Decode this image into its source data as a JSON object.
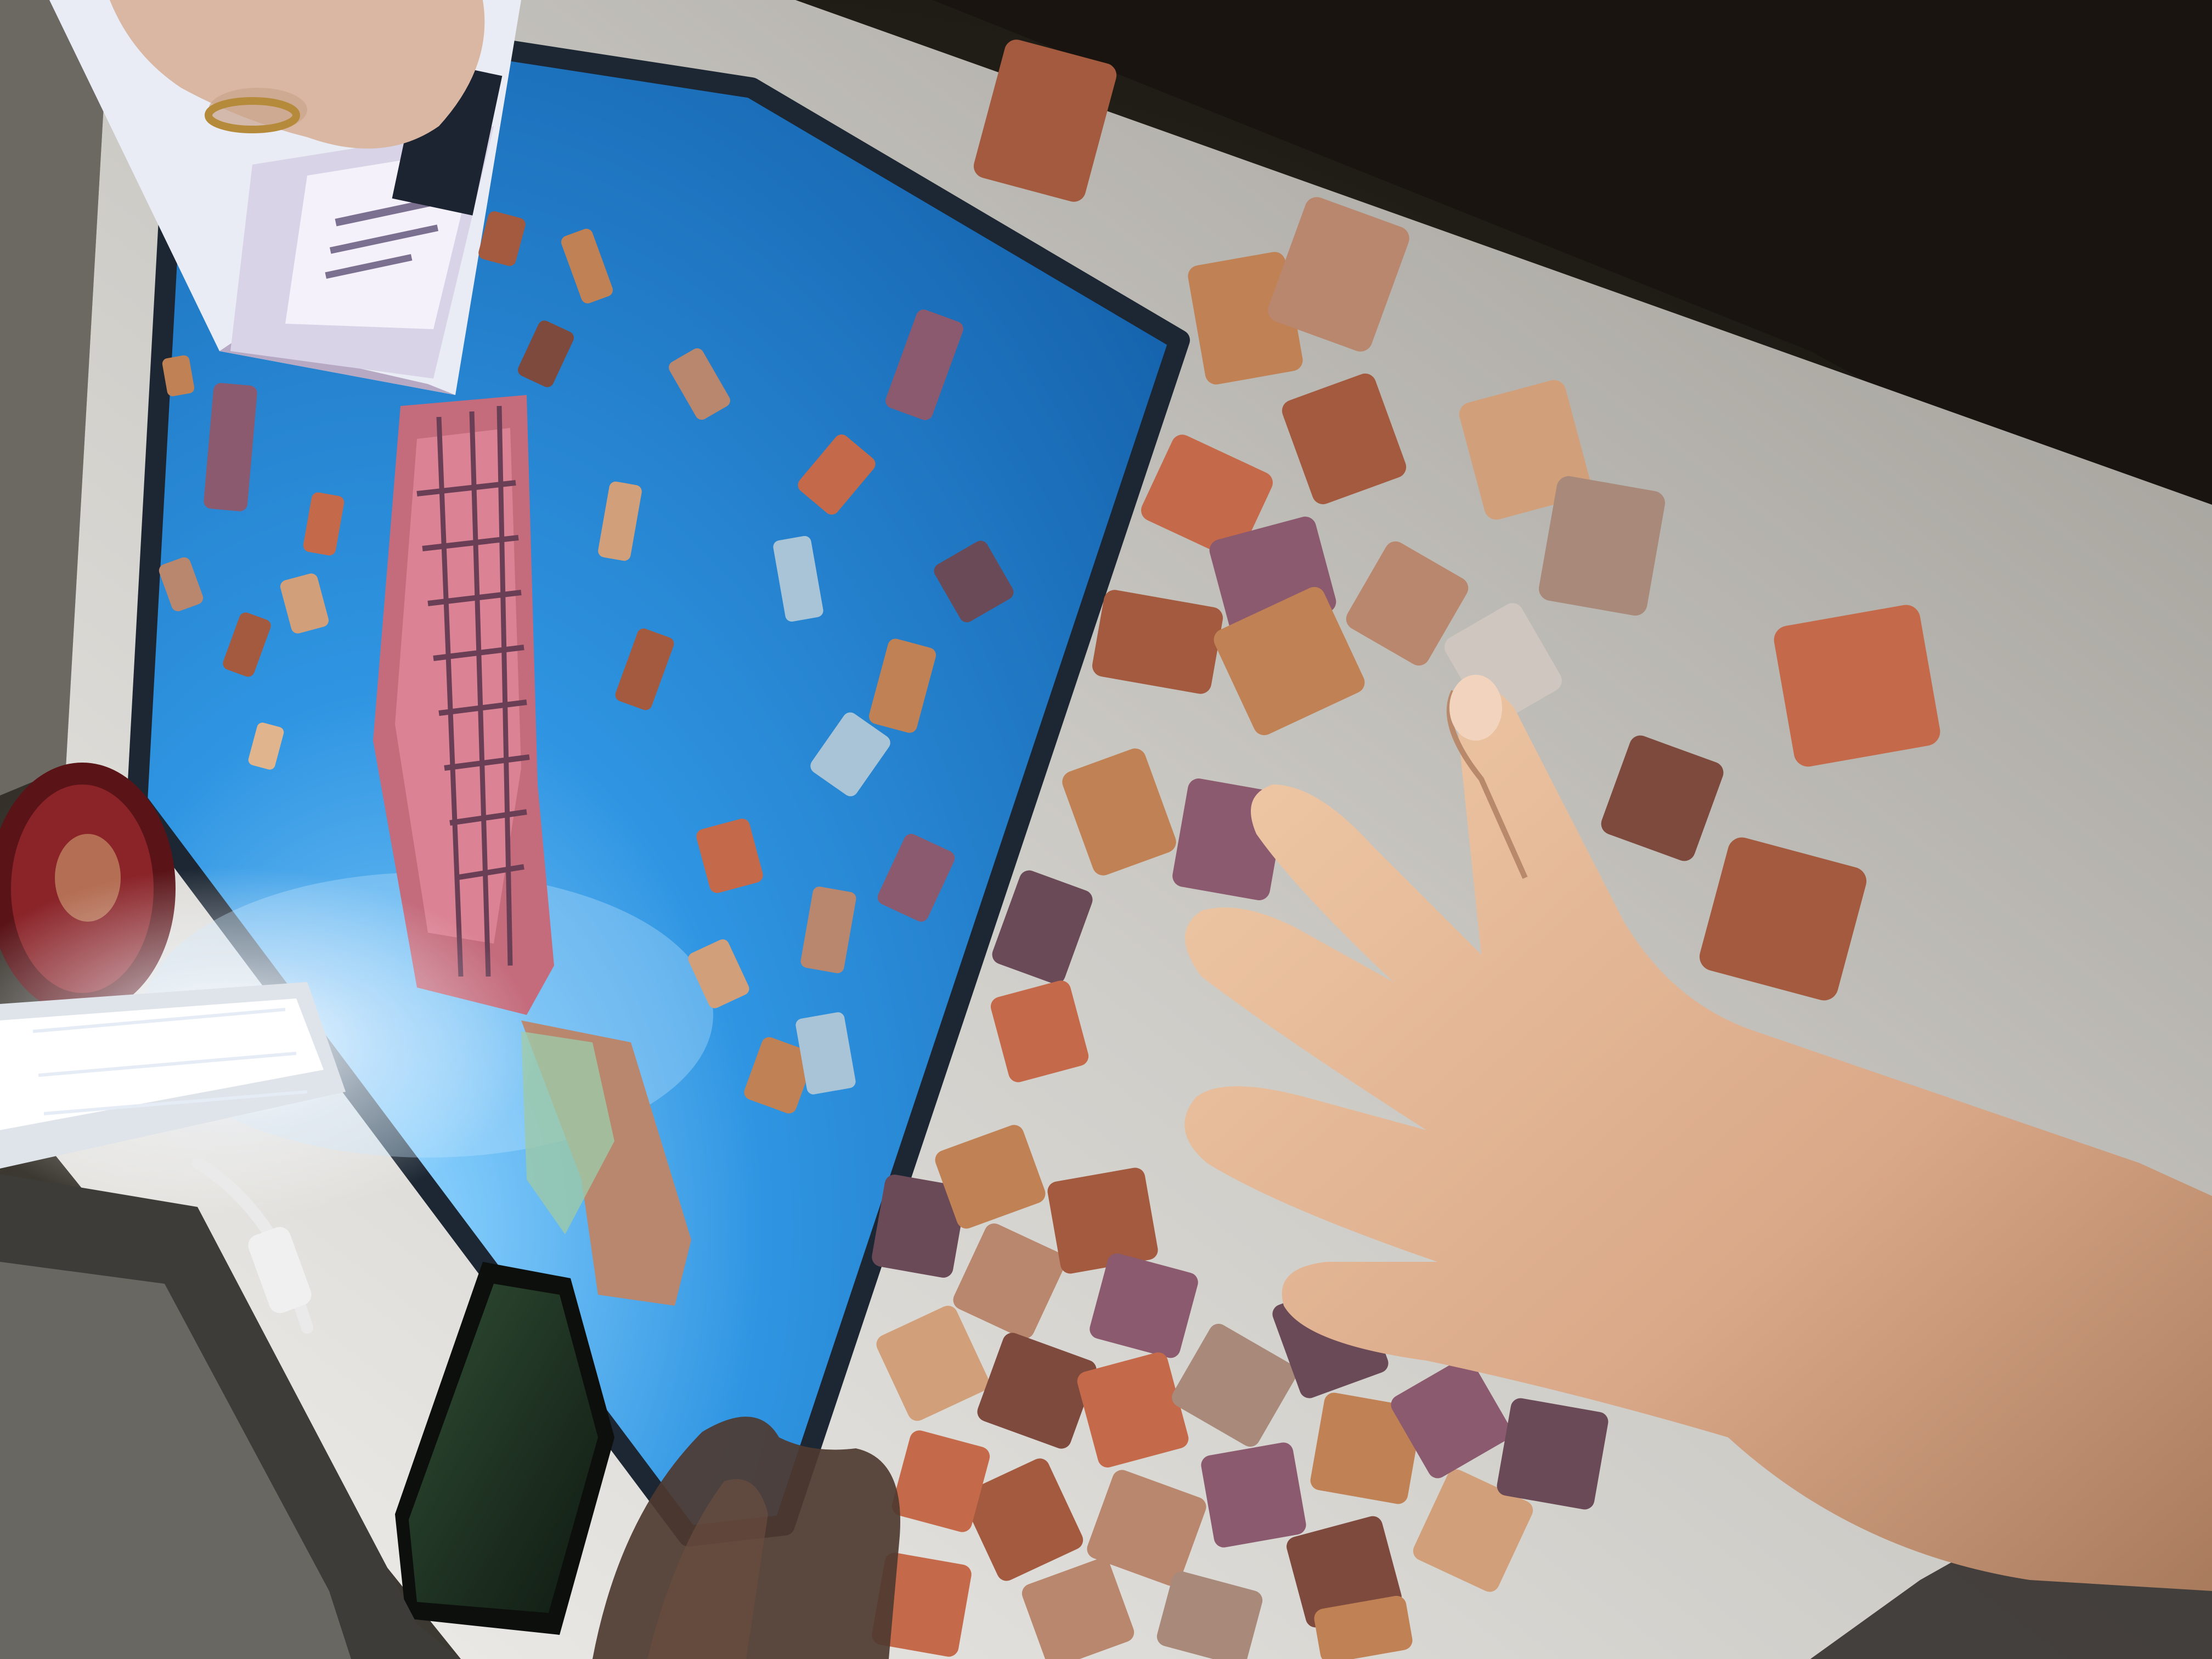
{
  "scene": {
    "colors": {
      "room": "#2c2824",
      "roomDark": "#161311",
      "table": "#cfcdc8",
      "tableLit": "#e7e6e2",
      "board": "#1f78c9",
      "boardLight": "#37a2ec",
      "boardEdge": "#1c2733",
      "skin": "#e2b894",
      "skinShadow": "#a77a5b",
      "phone": "#1d2a1e",
      "lamp": "#f2f4f7",
      "bowl": "#7a1f24"
    },
    "pieceColors": [
      "#a35a3f",
      "#c08155",
      "#7e4a3e",
      "#b9866e",
      "#8c5a6e",
      "#d1a07a",
      "#6b4a58",
      "#c46a4a",
      "#a8897a",
      "#e0b48c"
    ],
    "textures": {
      "puzzle-box": "box-texture",
      "lamp": "lamp-texture",
      "phone": "phone-texture"
    }
  }
}
